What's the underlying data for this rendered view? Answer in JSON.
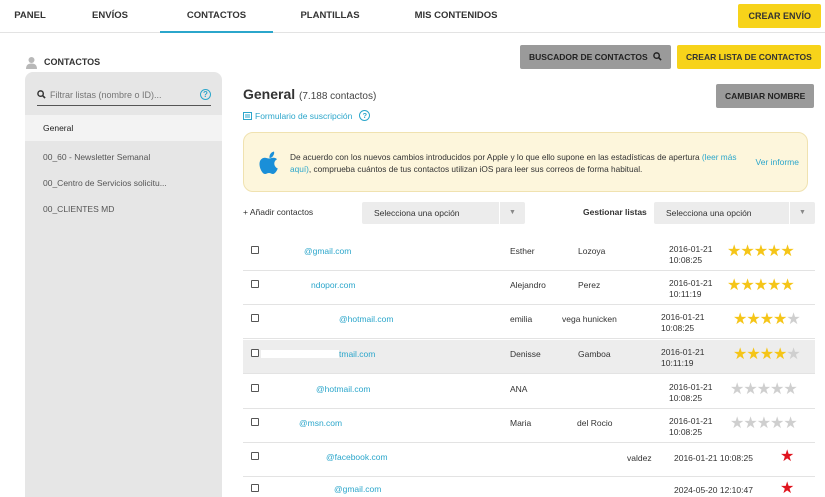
{
  "topnav": {
    "tabs": [
      {
        "label": "PANEL"
      },
      {
        "label": "ENVÍOS"
      },
      {
        "label": "CONTACTOS"
      },
      {
        "label": "PLANTILLAS"
      },
      {
        "label": "MIS CONTENIDOS"
      }
    ],
    "active_tab": "CONTACTOS",
    "create_send_label": "CREAR ENVÍO"
  },
  "section": {
    "title": "CONTACTOS",
    "search_contacts_label": "BUSCADOR DE CONTACTOS",
    "create_list_label": "CREAR LISTA DE CONTACTOS"
  },
  "sidebar": {
    "search_placeholder": "Filtrar listas (nombre o ID)...",
    "help_glyph": "?",
    "items": [
      {
        "label": "General"
      },
      {
        "label": "00_60 - Newsletter Semanal"
      },
      {
        "label": "00_Centro de Servicios solicitu..."
      },
      {
        "label": "00_CLIENTES MD"
      }
    ]
  },
  "main": {
    "title": "General",
    "count": "(7.188 contactos)",
    "rename_label": "CAMBIAR NOMBRE",
    "form_link": "Formulario de suscripción",
    "help_glyph": "?",
    "notice": {
      "text_before": "De acuerdo con los nuevos cambios introducidos por Apple y lo que ello supone en las estadísticas de apertura",
      "link": "(leer más aquí)",
      "text_after": ", comprueba cuántos de tus contactos utilizan iOS para leer sus correos de forma habitual.",
      "action": "Ver informe"
    },
    "add_contacts_label": "+ Añadir contactos",
    "add_select_value": "Selecciona una opción",
    "manage_lists_label": "Gestionar listas",
    "manage_select_value": "Selecciona una opción",
    "select_arrow": "▼"
  },
  "contacts": [
    {
      "email": "@gmail.com",
      "first": "Esther",
      "last": "Lozoya",
      "date": "2016-01-21",
      "time": "10:08:25",
      "stars": 5
    },
    {
      "email": "ndopor.com",
      "first": "Alejandro",
      "last": "Perez",
      "date": "2016-01-21",
      "time": "10:11:19",
      "stars": 5
    },
    {
      "email": "@hotmail.com",
      "first": "emilia",
      "last": "vega hunicken",
      "date": "2016-01-21",
      "time": "10:08:25",
      "stars": 4
    },
    {
      "email": "tmail.com",
      "first": "Denisse",
      "last": "Gamboa",
      "date": "2016-01-21",
      "time": "10:11:19",
      "stars": 4
    },
    {
      "email": "@hotmail.com",
      "first": "ANA",
      "last": "",
      "date": "2016-01-21",
      "time": "10:08:25",
      "stars": 0
    },
    {
      "email": "@msn.com",
      "first": "Maria",
      "last": "del Rocio",
      "date": "2016-01-21",
      "time": "10:08:25",
      "stars": 0
    },
    {
      "email": "@facebook.com",
      "first": "",
      "last": "valdez",
      "datetime": "2016-01-21 10:08:25",
      "stars": 1
    },
    {
      "email": "@gmail.com",
      "first": "",
      "last": "",
      "datetime": "2024-05-20 12:10:47",
      "stars": 1
    }
  ]
}
